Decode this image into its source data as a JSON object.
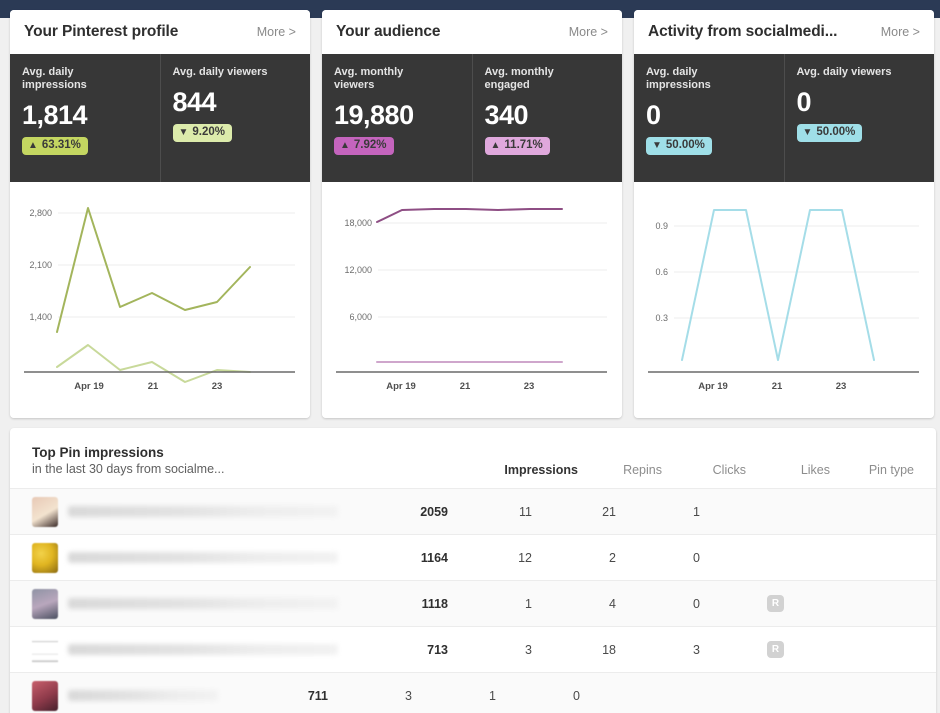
{
  "theme": {
    "page_background": "#2b3a55",
    "surface": "#f0f0f0",
    "card_background": "#ffffff",
    "stats_background": "#373737",
    "green_strong": "#c4d661",
    "green_light": "#dcebab",
    "purple_strong": "#c464bd",
    "purple_light": "#dfa8dc",
    "cyan": "#9fdfe8",
    "line_green_dark": "#a3b55c",
    "line_green_light": "#c8d99a",
    "line_purple_dark": "#8e4e84",
    "line_purple_light": "#cfa6cc",
    "line_cyan": "#a5dde8"
  },
  "cards": [
    {
      "title": "Your Pinterest profile",
      "more_label": "More >",
      "stats": [
        {
          "label": "Avg. daily impressions",
          "value": "1,814",
          "delta": "63.31%",
          "direction": "up",
          "badge_color": "#c4d661"
        },
        {
          "label": "Avg. daily viewers",
          "value": "844",
          "delta": "9.20%",
          "direction": "down",
          "badge_color": "#dcebab"
        }
      ],
      "chart_data": {
        "type": "line",
        "title": "Your Pinterest profile",
        "xlabel": "",
        "ylabel": "",
        "grid": true,
        "legend": "none",
        "x": [
          0,
          1,
          2,
          3,
          4,
          5,
          6,
          7,
          8
        ],
        "xtick_positions": [
          1,
          3,
          5
        ],
        "xtick_labels": [
          "Apr 19",
          "21",
          "23"
        ],
        "ytick_values": [
          1400,
          2100,
          2800
        ],
        "ytick_labels": [
          "1,400",
          "2,100",
          "2,800"
        ],
        "ylim": [
          0,
          3100
        ],
        "series": [
          {
            "name": "Avg. daily impressions",
            "color": "#a3b55c",
            "values": [
              1250,
              2880,
              1610,
              1780,
              1560,
              1640,
              2060
            ]
          },
          {
            "name": "Avg. daily viewers",
            "color": "#c8d99a",
            "values": [
              760,
              1050,
              780,
              860,
              610,
              770,
              720,
              700
            ]
          }
        ]
      }
    },
    {
      "title": "Your audience",
      "more_label": "More >",
      "stats": [
        {
          "label": "Avg. monthly viewers",
          "value": "19,880",
          "delta": "7.92%",
          "direction": "up",
          "badge_color": "#c464bd"
        },
        {
          "label": "Avg. monthly engaged",
          "value": "340",
          "delta": "11.71%",
          "direction": "up",
          "badge_color": "#dfa8dc"
        }
      ],
      "chart_data": {
        "type": "line",
        "title": "Your audience",
        "xlabel": "",
        "ylabel": "",
        "grid": true,
        "legend": "none",
        "xtick_labels": [
          "Apr 19",
          "21",
          "23"
        ],
        "ytick_values": [
          6000,
          12000,
          18000
        ],
        "ytick_labels": [
          "6,000",
          "12,000",
          "18,000"
        ],
        "ylim": [
          0,
          21000
        ],
        "series": [
          {
            "name": "Avg. monthly viewers",
            "color": "#8e4e84",
            "values": [
              18300,
              19700,
              19750,
              19800,
              19700,
              19800,
              19850
            ]
          },
          {
            "name": "Avg. monthly engaged",
            "color": "#cfa6cc",
            "values": [
              340,
              340,
              340,
              340,
              340,
              340,
              340
            ]
          }
        ]
      }
    },
    {
      "title": "Activity from socialmedi...",
      "more_label": "More >",
      "stats": [
        {
          "label": "Avg. daily impressions",
          "value": "0",
          "delta": "50.00%",
          "direction": "down",
          "badge_color": "#9fdfe8"
        },
        {
          "label": "Avg. daily viewers",
          "value": "0",
          "delta": "50.00%",
          "direction": "down",
          "badge_color": "#9fdfe8"
        }
      ],
      "chart_data": {
        "type": "line",
        "title": "Activity from socialmedi...",
        "xlabel": "",
        "ylabel": "",
        "grid": true,
        "legend": "none",
        "xtick_labels": [
          "Apr 19",
          "21",
          "23"
        ],
        "ytick_values": [
          0.3,
          0.6,
          0.9
        ],
        "ytick_labels": [
          "0.3",
          "0.6",
          "0.9"
        ],
        "ylim": [
          0,
          1.1
        ],
        "series": [
          {
            "name": "Activity",
            "color": "#a5dde8",
            "values": [
              0,
              1,
              1,
              0,
              1,
              1,
              0
            ]
          }
        ]
      }
    }
  ],
  "table": {
    "title": "Top Pin impressions",
    "subtitle": "in the last 30 days from socialme...",
    "columns": [
      {
        "key": "impressions",
        "label": "Impressions",
        "active": true
      },
      {
        "key": "repins",
        "label": "Repins",
        "active": false
      },
      {
        "key": "clicks",
        "label": "Clicks",
        "active": false
      },
      {
        "key": "likes",
        "label": "Likes",
        "active": false
      },
      {
        "key": "pin_type",
        "label": "Pin type",
        "active": false
      }
    ],
    "rows": [
      {
        "impressions": "2059",
        "repins": "11",
        "clicks": "21",
        "likes": "1",
        "pin_type": "",
        "thumb_colors": [
          "#e8c9b6",
          "#f3e3cf",
          "#3a2a28"
        ]
      },
      {
        "impressions": "1164",
        "repins": "12",
        "clicks": "2",
        "likes": "0",
        "pin_type": "",
        "thumb_colors": [
          "#e0b521",
          "#f2d24a",
          "#8a6a12"
        ]
      },
      {
        "impressions": "1118",
        "repins": "1",
        "clicks": "4",
        "likes": "0",
        "pin_type": "R",
        "thumb_colors": [
          "#8f93a4",
          "#b9a7bd",
          "#4a4f60"
        ]
      },
      {
        "impressions": "713",
        "repins": "3",
        "clicks": "18",
        "likes": "3",
        "pin_type": "R",
        "thumb_colors": [
          "#ffffff",
          "#f4f4f4",
          "#d8d8d8"
        ]
      },
      {
        "impressions": "711",
        "repins": "3",
        "clicks": "1",
        "likes": "0",
        "pin_type": "",
        "thumb_colors": [
          "#8e3a4a",
          "#c85f6c",
          "#46202c"
        ]
      }
    ]
  }
}
